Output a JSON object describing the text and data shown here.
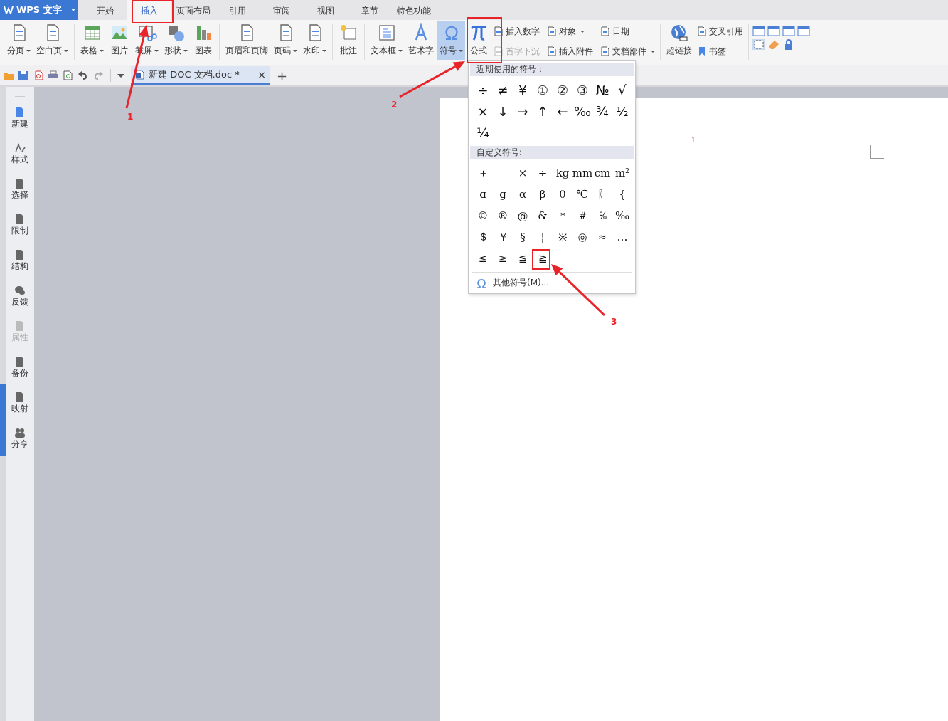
{
  "app_menu": {
    "label": "WPS 文字"
  },
  "tabs": [
    {
      "label": "开始",
      "selected": false
    },
    {
      "label": "插入",
      "selected": true
    },
    {
      "label": "页面布局",
      "selected": false
    },
    {
      "label": "引用",
      "selected": false
    },
    {
      "label": "审阅",
      "selected": false
    },
    {
      "label": "视图",
      "selected": false
    },
    {
      "label": "章节",
      "selected": false
    },
    {
      "label": "特色功能",
      "selected": false
    }
  ],
  "ribbon": {
    "groups": [
      {
        "buttons": [
          {
            "label": "分页",
            "dropdown": true,
            "active": false
          },
          {
            "label": "空白页",
            "dropdown": true,
            "active": false
          }
        ]
      },
      {
        "buttons": [
          {
            "label": "表格",
            "dropdown": true,
            "active": false
          },
          {
            "label": "图片",
            "dropdown": false,
            "active": false
          },
          {
            "label": "截屏",
            "dropdown": true,
            "active": false
          },
          {
            "label": "形状",
            "dropdown": true,
            "active": false
          },
          {
            "label": "图表",
            "dropdown": false,
            "active": false
          }
        ]
      },
      {
        "buttons": [
          {
            "label": "页眉和页脚",
            "dropdown": false,
            "active": false
          },
          {
            "label": "页码",
            "dropdown": true,
            "active": false
          },
          {
            "label": "水印",
            "dropdown": true,
            "active": false
          }
        ]
      },
      {
        "buttons": [
          {
            "label": "批注",
            "dropdown": false,
            "active": false
          }
        ]
      },
      {
        "buttons": [
          {
            "label": "文本框",
            "dropdown": true,
            "active": false
          },
          {
            "label": "艺术字",
            "dropdown": false,
            "active": false
          },
          {
            "label": "符号",
            "dropdown": true,
            "active": true
          },
          {
            "label": "公式",
            "dropdown": false,
            "active": false
          }
        ],
        "small_buttons": [
          {
            "label": "插入数字",
            "dropdown": false,
            "disabled": false
          },
          {
            "label": "首字下沉",
            "dropdown": false,
            "disabled": true
          },
          {
            "label": "对象",
            "dropdown": true,
            "disabled": false
          },
          {
            "label": "插入附件",
            "dropdown": false,
            "disabled": false
          },
          {
            "label": "日期",
            "dropdown": false,
            "disabled": false
          },
          {
            "label": "文档部件",
            "dropdown": true,
            "disabled": false
          }
        ]
      },
      {
        "buttons": [
          {
            "label": "超链接",
            "dropdown": false,
            "active": false
          }
        ],
        "small_buttons": [
          {
            "label": "交叉引用",
            "dropdown": false,
            "disabled": false
          },
          {
            "label": "书签",
            "dropdown": false,
            "disabled": false
          }
        ]
      }
    ]
  },
  "document_tab": {
    "title": "新建 DOC 文档.doc *",
    "close": "×"
  },
  "new_tab": "+",
  "sidebar": {
    "items": [
      {
        "label": "新建",
        "disabled": false
      },
      {
        "label": "样式",
        "disabled": false
      },
      {
        "label": "选择",
        "disabled": false
      },
      {
        "label": "限制",
        "disabled": false
      },
      {
        "label": "结构",
        "disabled": false
      },
      {
        "label": "反馈",
        "disabled": false
      },
      {
        "label": "属性",
        "disabled": true
      },
      {
        "label": "备份",
        "disabled": false
      },
      {
        "label": "映射",
        "disabled": false
      },
      {
        "label": "分享",
        "disabled": false
      }
    ]
  },
  "document": {
    "page_number": "1"
  },
  "symbol_menu": {
    "sections": [
      {
        "title": "近期使用的符号：",
        "symbols": [
          "÷",
          "≠",
          "¥",
          "①",
          "②",
          "③",
          "№",
          "√",
          "×",
          "↓",
          "→",
          "↑",
          "←",
          "‰",
          "¾",
          "½",
          "¼"
        ]
      },
      {
        "title": "自定义符号:",
        "symbols": [
          "＋",
          "—",
          "×",
          "÷",
          "kg",
          "mm",
          "cm",
          "m²",
          "ɑ",
          "g",
          "α",
          "β",
          "θ",
          "℃",
          "〖",
          "{",
          "©",
          "®",
          "@",
          "&",
          "＊",
          "＃",
          "％",
          "‰",
          "＄",
          "￥",
          "§",
          "¦",
          "※",
          "◎",
          "≈",
          "…",
          "≤",
          "≥",
          "≦",
          "≧"
        ]
      }
    ],
    "footer": "其他符号(M)..."
  },
  "annotations": [
    {
      "label": "1"
    },
    {
      "label": "2"
    },
    {
      "label": "3"
    }
  ]
}
